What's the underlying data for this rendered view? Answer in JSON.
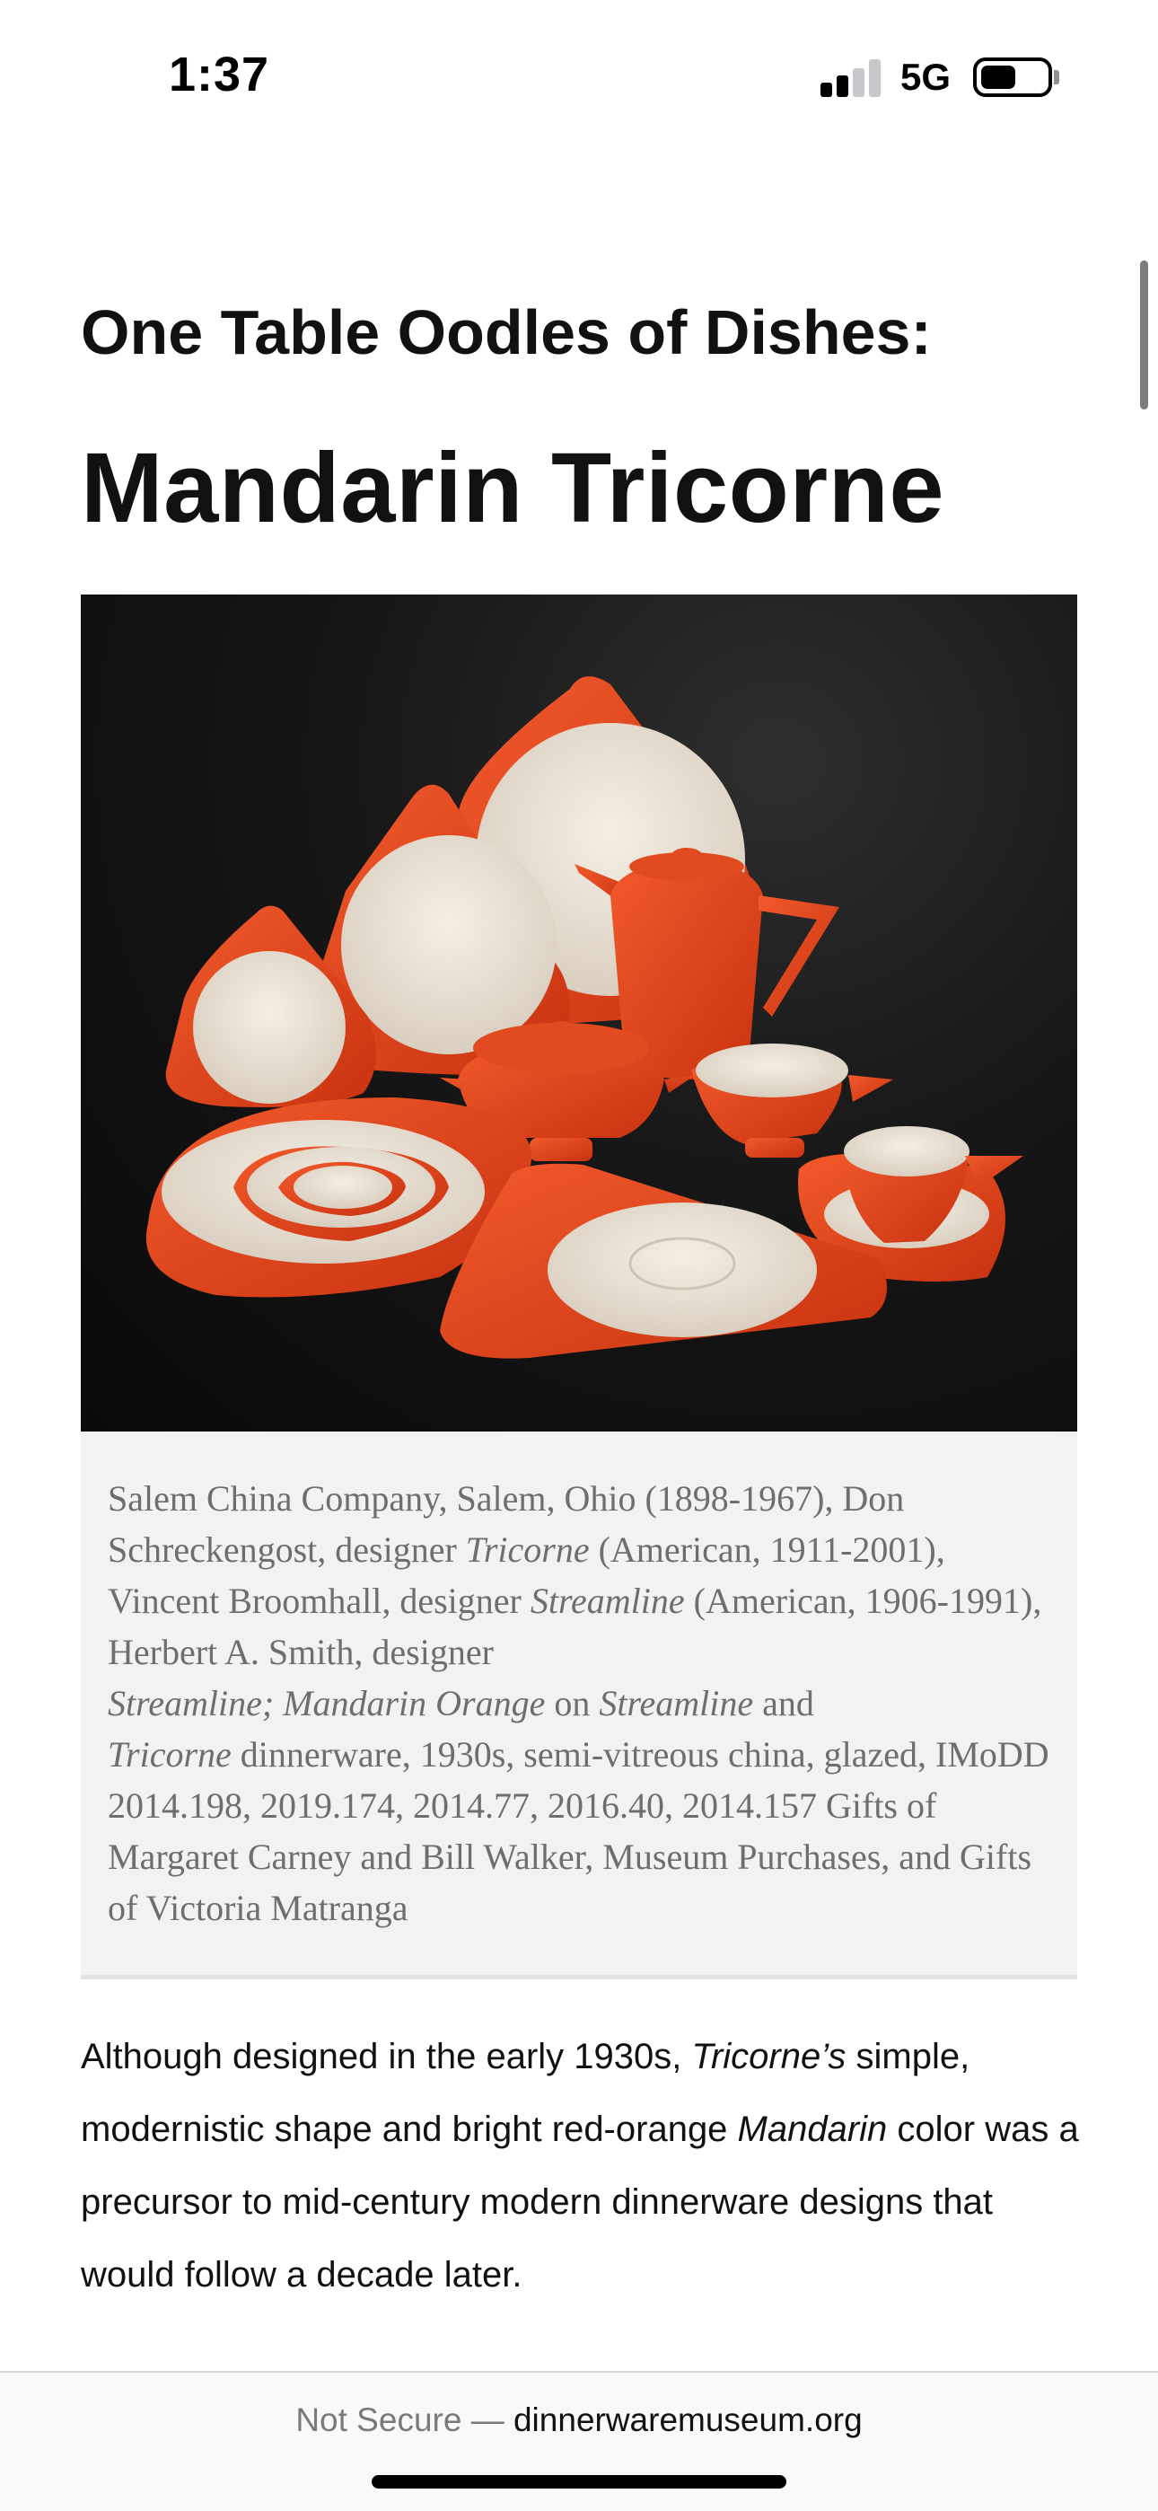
{
  "status_bar": {
    "time": "1:37",
    "network": "5G"
  },
  "article": {
    "kicker": "One Table Oodles of Dishes:",
    "title": "Mandarin Tricorne",
    "image_description_icon": "tableware-photo",
    "caption": {
      "t1": "Salem China Company, Salem, Ohio (1898-1967), Don Schreckengost, designer ",
      "i1": "Tricorne",
      "t2": " (American, 1911-2001), Vincent Broomhall, designer ",
      "i2": "Streamline",
      "t3": " (American, 1906-1991), Herbert A. Smith, designer ",
      "i3": "Streamline; Mandarin Orange",
      "t4": " on ",
      "i4": "Streamline",
      "t5": " and ",
      "i5": "Tricorne",
      "t6": " dinnerware, 1930s, semi-vitreous china, glazed, IMoDD 2014.198, 2019.174, 2014.77, 2016.40, 2014.157 Gifts of Margaret Carney and Bill Walker, Museum Purchases, and Gifts of Victoria Matranga"
    },
    "body": {
      "t1": "Although designed in the early 1930s, ",
      "i1": "Tricorne’s",
      "t2": " simple, modernistic shape and bright red-orange ",
      "i2": "Mandarin",
      "t3": " color was a precursor to mid-century modern dinnerware designs that would follow a decade later."
    }
  },
  "browser": {
    "not_secure": "Not Secure —",
    "domain": "dinnerwaremuseum.org"
  },
  "colors": {
    "mandarin": "#e8401c",
    "cream": "#ede6da",
    "caption_bg": "#f2f2f2"
  }
}
